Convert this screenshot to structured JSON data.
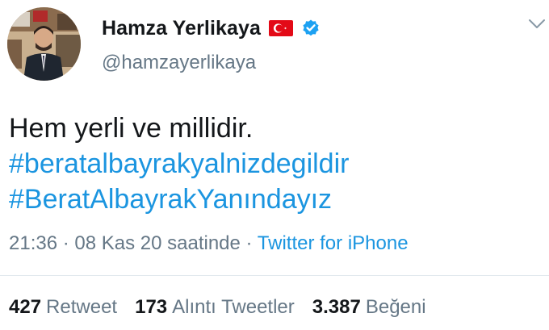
{
  "user": {
    "display_name": "Hamza Yerlikaya",
    "handle": "@hamzayerlikaya",
    "badge_icon": "verified-icon",
    "flag_icon": "turkey-flag-icon"
  },
  "tweet": {
    "line1": "Hem yerli ve millidir.",
    "hashtag1": "#beratalbayrakyalnizdegildir",
    "hashtag2": "#BeratAlbayrakYanındayız",
    "time": "21:36",
    "sep1": " · ",
    "date": "08 Kas 20 saatinde",
    "sep2": " · ",
    "source": "Twitter for iPhone"
  },
  "stats": [
    {
      "count": "427",
      "label": "Retweet"
    },
    {
      "count": "173",
      "label": "Alıntı Tweetler"
    },
    {
      "count": "3.387",
      "label": "Beğeni"
    }
  ],
  "colors": {
    "link": "#1b95e0",
    "secondary_text": "#657786",
    "primary_text": "#14171a",
    "verified": "#1da1f2",
    "flag_red": "#e30a17"
  }
}
